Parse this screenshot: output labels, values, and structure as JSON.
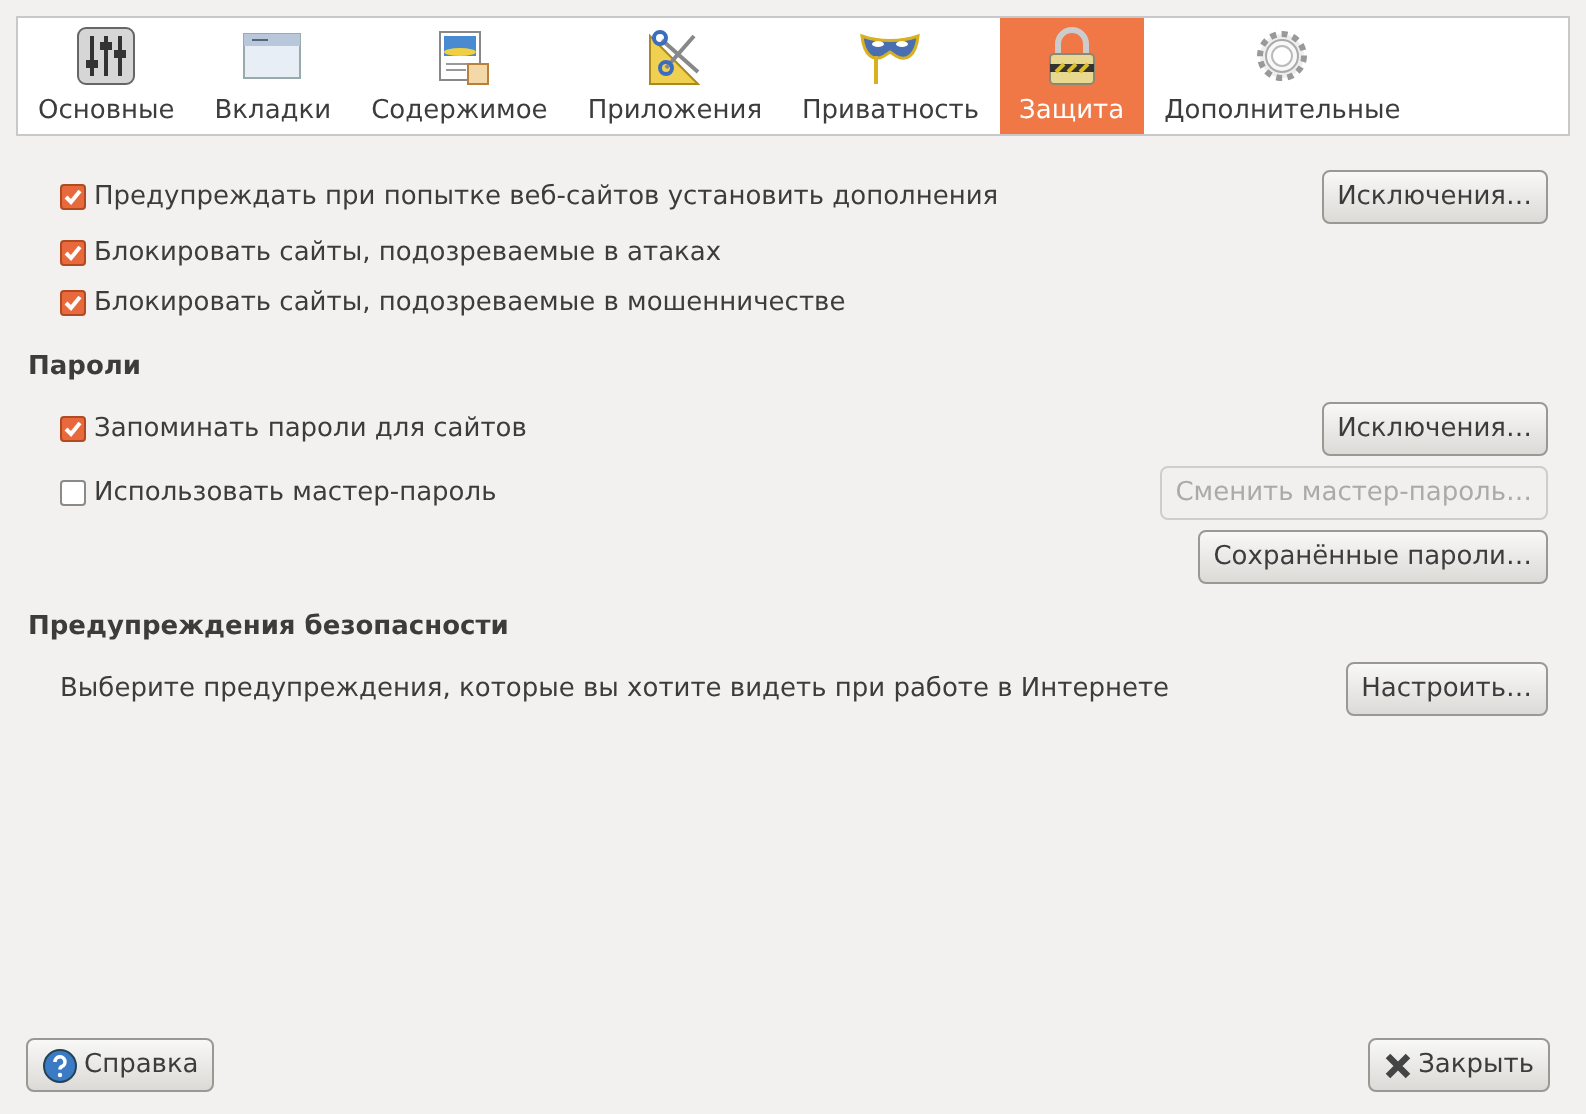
{
  "tabs": [
    {
      "label": "Основные",
      "kind": "sliders",
      "selected": false
    },
    {
      "label": "Вкладки",
      "kind": "window",
      "selected": false
    },
    {
      "label": "Содержимое",
      "kind": "document",
      "selected": false
    },
    {
      "label": "Приложения",
      "kind": "scissors",
      "selected": false
    },
    {
      "label": "Приватность",
      "kind": "mask",
      "selected": false
    },
    {
      "label": "Защита",
      "kind": "lock",
      "selected": true
    },
    {
      "label": "Дополнительные",
      "kind": "gear",
      "selected": false
    }
  ],
  "rows": [
    {
      "kind": "checkbox",
      "label": "Предупреждать при попытке веб-сайтов установить дополнения",
      "checked": true,
      "button": {
        "label": "Исключения…",
        "disabled": false
      }
    },
    {
      "kind": "checkbox",
      "label": "Блокировать сайты, подозреваемые в атаках",
      "checked": true
    },
    {
      "kind": "checkbox",
      "label": "Блокировать сайты, подозреваемые в мошенничестве",
      "checked": true
    },
    {
      "kind": "heading",
      "label": "Пароли"
    },
    {
      "kind": "checkbox",
      "label": "Запоминать пароли для сайтов",
      "checked": true,
      "button": {
        "label": "Исключения…",
        "disabled": false
      }
    },
    {
      "kind": "checkbox",
      "label": "Использовать мастер-пароль",
      "checked": false,
      "button": {
        "label": "Сменить мастер-пароль…",
        "disabled": true
      }
    },
    {
      "kind": "button",
      "button": {
        "label": "Сохранённые пароли…",
        "disabled": false
      }
    },
    {
      "kind": "heading",
      "label": "Предупреждения безопасности"
    },
    {
      "kind": "text",
      "label": "Выберите предупреждения, которые вы хотите видеть при работе в Интернете",
      "button": {
        "label": "Настроить…",
        "disabled": false
      }
    }
  ],
  "footer": [
    {
      "label": "Справка",
      "kind": "help"
    },
    {
      "label": "Закрыть",
      "kind": "close"
    }
  ]
}
